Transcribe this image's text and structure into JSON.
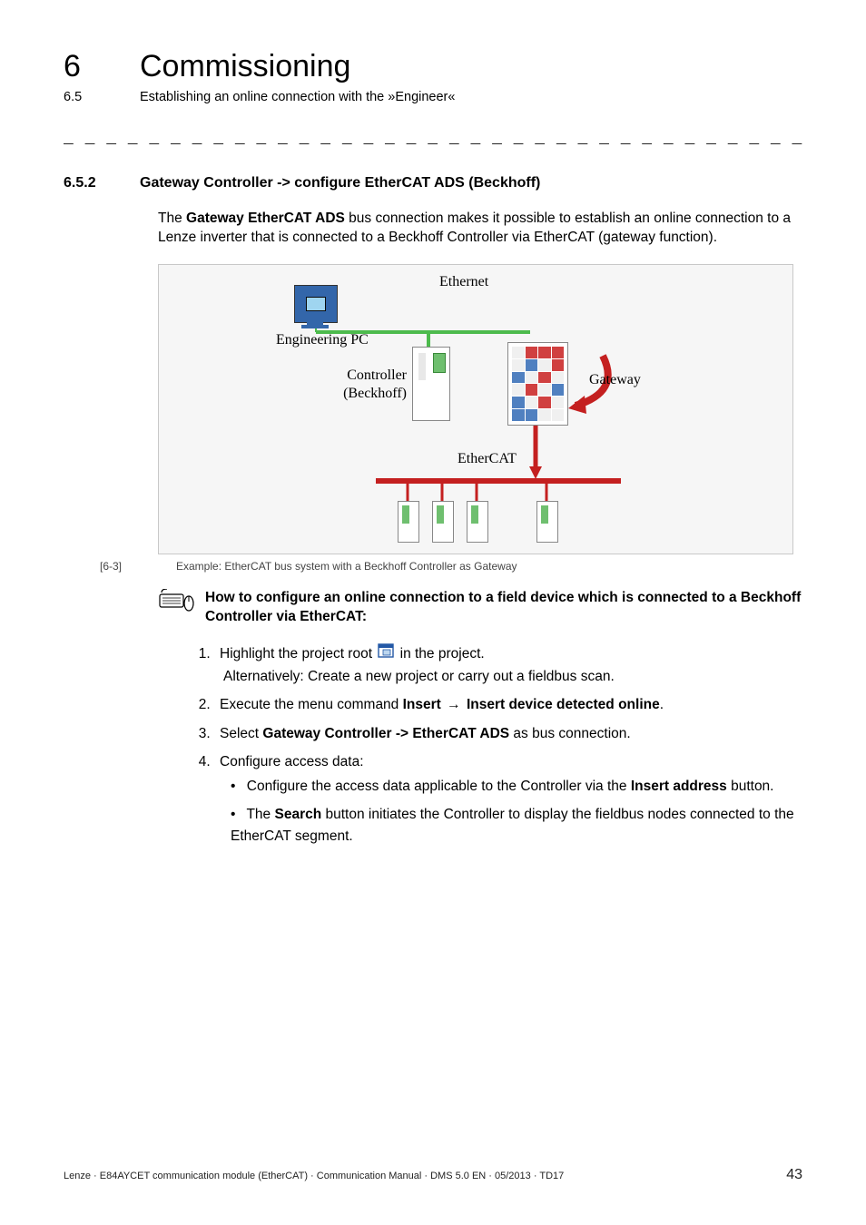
{
  "header": {
    "chapter_num": "6",
    "chapter_title": "Commissioning",
    "section_num": "6.5",
    "section_title": "Establishing an online connection with the »Engineer«"
  },
  "section": {
    "num": "6.5.2",
    "title": "Gateway Controller -> configure EtherCAT ADS (Beckhoff)"
  },
  "intro": {
    "pre": "The ",
    "bold": "Gateway EtherCAT ADS",
    "post": " bus connection makes it possible to establish an online connection to a Lenze inverter that is connected to a Beckhoff Controller via EtherCAT (gateway function)."
  },
  "figure": {
    "labels": {
      "ethernet": "Ethernet",
      "engineering_pc": "Engineering PC",
      "controller_l1": "Controller",
      "controller_l2": "(Beckhoff)",
      "gateway": "Gateway",
      "ethercat": "EtherCAT"
    },
    "caption_num": "[6-3]",
    "caption_text": "Example: EtherCAT bus system with a Beckhoff Controller as Gateway"
  },
  "howto": {
    "line1": "How to configure an online connection to a field device which is connected to a Beckhoff",
    "line2": "Controller via EtherCAT:"
  },
  "steps": {
    "s1a": "Highlight the project root ",
    "s1b": " in the project.",
    "s1sub": "Alternatively: Create a new project or carry out a fieldbus scan.",
    "s2a": "Execute the menu command ",
    "s2b_insert": "Insert",
    "s2c_arrow": "→",
    "s2d_cmd": "Insert device detected online",
    "s2e": ".",
    "s3a": "Select ",
    "s3b": "Gateway Controller -> EtherCAT ADS",
    "s3c": " as bus connection.",
    "s4": "Configure access data:",
    "s4b1a": "Configure the access data applicable to the Controller via the ",
    "s4b1b": "Insert address",
    "s4b1c": " button.",
    "s4b2a": "The ",
    "s4b2b": "Search",
    "s4b2c": " button initiates the Controller to display the fieldbus nodes connected to the EtherCAT segment."
  },
  "footer": {
    "text": "Lenze · E84AYCET communication module (EtherCAT) · Communication Manual · DMS 5.0 EN · 05/2013 · TD17",
    "page": "43"
  },
  "dashes": "_ _ _ _ _ _ _ _ _ _ _ _ _ _ _ _ _ _ _ _ _ _ _ _ _ _ _ _ _ _ _ _ _ _ _ _ _ _ _ _ _ _ _ _ _ _ _ _ _ _ _ _ _ _ _ _ _ _ _ _ _ _ _ _"
}
